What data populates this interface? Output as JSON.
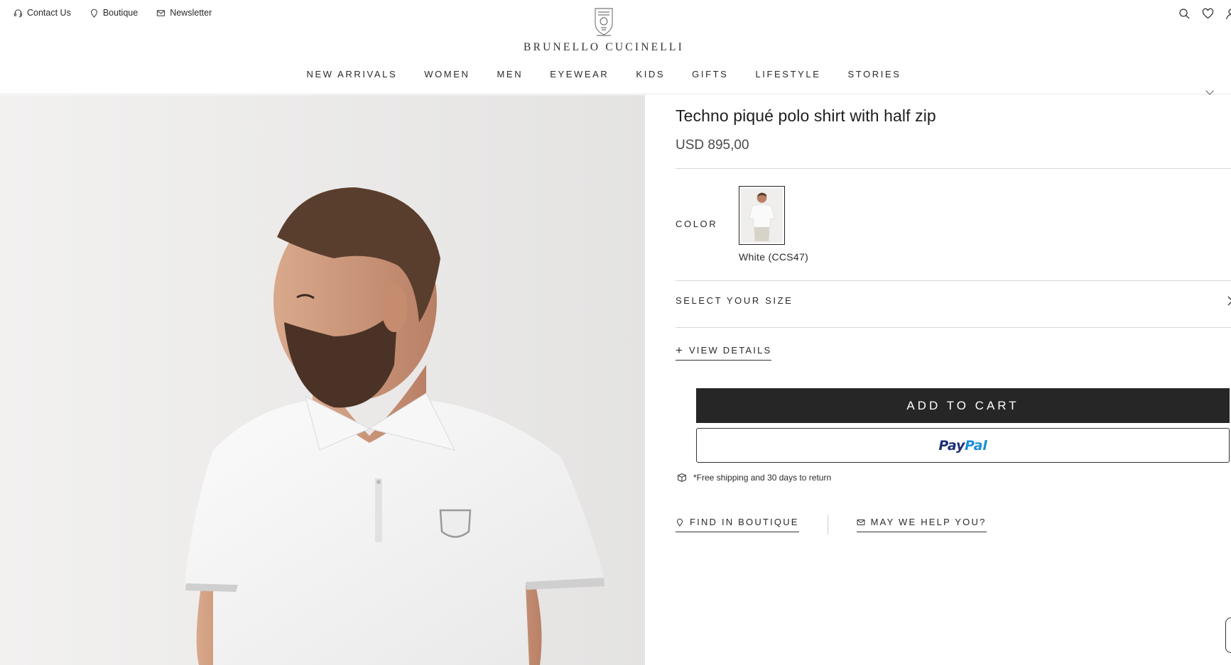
{
  "header": {
    "utility_links": [
      {
        "label": "Contact Us",
        "icon": "headset-icon"
      },
      {
        "label": "Boutique",
        "icon": "location-pin-icon"
      },
      {
        "label": "Newsletter",
        "icon": "envelope-icon"
      }
    ],
    "brand_name": "BRUNELLO CUCINELLI",
    "icons": [
      "search-icon",
      "heart-icon",
      "user-icon"
    ]
  },
  "nav": {
    "items": [
      "NEW ARRIVALS",
      "WOMEN",
      "MEN",
      "EYEWEAR",
      "KIDS",
      "GIFTS",
      "LIFESTYLE",
      "STORIES"
    ]
  },
  "product": {
    "title": "Techno piqué polo shirt with half zip",
    "price": "USD 895,00",
    "color_label": "COLOR",
    "selected_color": "White (CCS47)",
    "size_label": "SELECT YOUR SIZE",
    "view_details": "VIEW DETAILS",
    "add_to_cart": "ADD TO CART",
    "paypal": {
      "part1": "Pay",
      "part2": "Pal"
    },
    "shipping_note": "*Free shipping and 30 days to return",
    "find_in_boutique": "FIND IN BOUTIQUE",
    "help": "MAY WE HELP YOU?"
  },
  "colors": {
    "primary_button": "#262626",
    "paypal_navy": "#1b2e78",
    "paypal_blue": "#1b8fd6",
    "hero_background": "#ecebea"
  }
}
